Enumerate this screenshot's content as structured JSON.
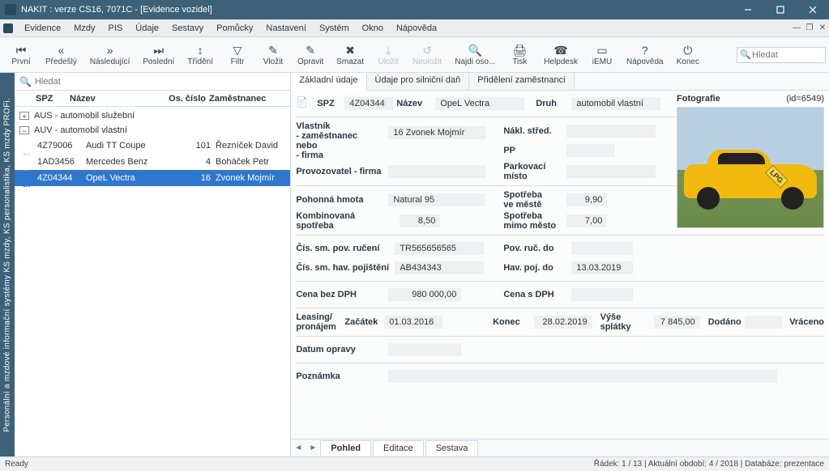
{
  "window": {
    "title": "NAKIT :           verze CS16, 7071C - [Evidence vozidel]"
  },
  "menu": [
    "Evidence",
    "Mzdy",
    "PIS",
    "Údaje",
    "Sestavy",
    "Pomůcky",
    "Nastavení",
    "Systém",
    "Okno",
    "Nápověda"
  ],
  "toolbar": [
    {
      "label": "První",
      "icon": "⏮"
    },
    {
      "label": "Předešlý",
      "icon": "«"
    },
    {
      "label": "Následující",
      "icon": "»"
    },
    {
      "label": "Poslední",
      "icon": "⏭"
    },
    {
      "label": "Třídění",
      "icon": "↕"
    },
    {
      "label": "Filtr",
      "icon": "▽"
    },
    {
      "label": "Vložit",
      "icon": "✎"
    },
    {
      "label": "Opravit",
      "icon": "✎"
    },
    {
      "label": "Smazat",
      "icon": "✖"
    },
    {
      "label": "Uložit",
      "icon": "⤓",
      "disabled": true
    },
    {
      "label": "Neuložit",
      "icon": "↺",
      "disabled": true
    },
    {
      "label": "Najdi oso...",
      "icon": "🔍"
    },
    {
      "label": "Tisk",
      "icon": "🖨"
    },
    {
      "label": "Helpdesk",
      "icon": "☎"
    },
    {
      "label": "iEMU",
      "icon": "▭"
    },
    {
      "label": "Nápověda",
      "icon": "?"
    },
    {
      "label": "Konec",
      "icon": "⏻"
    }
  ],
  "toolbar_search_placeholder": "Hledat",
  "sidebar_text": "Personální a mzdové informační systémy KS mzdy, KS personalistika, KS mzdy PROFi.",
  "left": {
    "search_placeholder": "Hledat",
    "headers": {
      "spz": "SPZ",
      "nazev": "Název",
      "os": "Os. číslo",
      "zam": "Zaměstnanec"
    },
    "groups": [
      {
        "exp": "+",
        "label": "AUS - automobil služební"
      },
      {
        "exp": "−",
        "label": "AUV - automobil vlastní"
      }
    ],
    "rows": [
      {
        "spz": "4Z79006",
        "nazev": "Audi TT Coupe",
        "os": "101",
        "zam": "Řezníček David"
      },
      {
        "spz": "1AD3456",
        "nazev": "Mercedes Benz",
        "os": "4",
        "zam": "Boháček Petr"
      },
      {
        "spz": "4Z04344",
        "nazev": "OpeL Vectra",
        "os": "16",
        "zam": "Zvonek Mojmír",
        "selected": true
      }
    ]
  },
  "tabs": [
    "Základní údaje",
    "Údaje pro silniční daň",
    "Přidělení zaměstnanci"
  ],
  "form": {
    "spz_lbl": "SPZ",
    "spz": "4Z04344",
    "nazev_lbl": "Název",
    "nazev": "OpeL Vectra",
    "druh_lbl": "Druh",
    "druh": "automobil vlastní",
    "vlastnik_lbl": "Vlastník\n- zaměstnanec\nnebo\n- firma",
    "vlastnik": "16 Zvonek Mojmír",
    "nakl_lbl": "Nákl. střed.",
    "nakl": "",
    "pp_lbl": "PP",
    "pp": "",
    "prov_lbl": "Provozovatel - firma",
    "prov": "",
    "park_lbl": "Parkovací\nmísto",
    "park": "",
    "ph_lbl": "Pohonná hmota",
    "ph": "Natural 95",
    "sm_lbl": "Spotřeba\nve městě",
    "sm": "9,90",
    "ks_lbl": "Kombinovaná spotřeba",
    "ks": "8,50",
    "smm_lbl": "Spotřeba\nmimo město",
    "smm": "7,00",
    "cpr_lbl": "Čís. sm. pov. ručení",
    "cpr": "TR565656565",
    "prd_lbl": "Pov. ruč. do",
    "prd": "",
    "chp_lbl": "Čís. sm. hav. pojištění",
    "chp": "AB434343",
    "hpd_lbl": "Hav. poj. do",
    "hpd": "13.03.2019",
    "cbd_lbl": "Cena bez DPH",
    "cbd": "980 000,00",
    "csd_lbl": "Cena s DPH",
    "csd": "",
    "lp_lbl": "Leasing/\npronájem",
    "zac_lbl": "Začátek",
    "zac": "01.03.2016",
    "kon_lbl": "Konec",
    "kon": "28.02.2019",
    "vs_lbl": "Výše splátky",
    "vs": "7 845,00",
    "dod_lbl": "Dodáno",
    "dod": "",
    "vra_lbl": "Vráceno",
    "do_lbl": "Datum opravy",
    "do": "",
    "pz_lbl": "Poznámka",
    "pz": ""
  },
  "photo": {
    "title": "Fotografie",
    "id": "(id=6549)",
    "lpg": "LPG"
  },
  "bottom_tabs": [
    "Pohled",
    "Editace",
    "Sestava"
  ],
  "status": {
    "left": "Ready",
    "right": "Řádek: 1 / 13 | Aktuální období: 4 / 2018 | Databáze: prezentace"
  }
}
